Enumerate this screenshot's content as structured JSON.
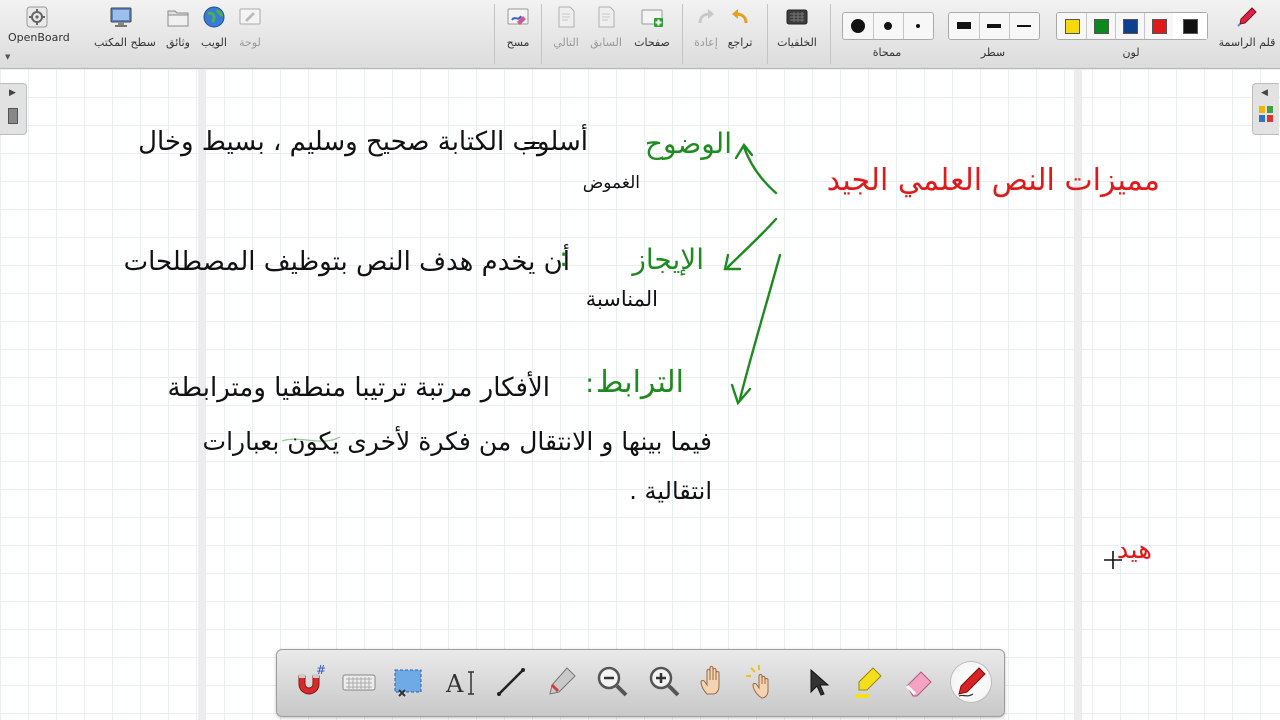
{
  "toolbar": {
    "app_label": "OpenBoard",
    "left_items": [
      {
        "label": "سطح المكتب",
        "icon": "desktop-icon",
        "dim": false
      },
      {
        "label": "وثائق",
        "icon": "folder-icon",
        "dim": false
      },
      {
        "label": "الويب",
        "icon": "globe-icon",
        "dim": false
      },
      {
        "label": "لوحة",
        "icon": "board-icon",
        "dim": true
      }
    ],
    "erase_label": "مسح",
    "pages": [
      {
        "label": "التالي",
        "icon": "next-page-icon",
        "dim": true
      },
      {
        "label": "السابق",
        "icon": "previous-page-icon",
        "dim": true
      },
      {
        "label": "صفحات",
        "icon": "add-page-icon",
        "dim": false
      }
    ],
    "history": [
      {
        "label": "إعادة",
        "icon": "redo-icon",
        "dim": true
      },
      {
        "label": "تراجع",
        "icon": "undo-icon",
        "dim": false
      }
    ],
    "backgrounds_label": "الخلفيات",
    "eraser_label": "ممحاة",
    "line_label": "سطر",
    "color_label": "لون",
    "pen_label": "قلم الراسمة",
    "colors": [
      "#f5d90a",
      "#0a8a1a",
      "#0d3f8e",
      "#e31818",
      "#111111"
    ],
    "selected_color": "#111111"
  },
  "board": {
    "title": "مميزات النص العلمي الجيد",
    "items": [
      {
        "heading": "الوضوح",
        "body": "أسلوب الكتابة صحيح وسليم ، بسيط وخال",
        "cont": "الغموض"
      },
      {
        "heading": "الإيجاز",
        "body": "أن يخدم هدف النص بتوظيف المصطلحات",
        "cont": "المناسبة"
      },
      {
        "heading": "الترابط",
        "body": "الأفكار مرتبة ترتيبا منطقيا ومترابطة",
        "cont": "فيما بينها و الانتقال من فكرة لأخرى يكون بعبارات",
        "cont2": "انتقالية ."
      }
    ],
    "note": "هيد"
  },
  "dock": [
    "magnet-icon",
    "keyboard-icon",
    "capture-icon",
    "text-tool-icon",
    "line-tool-icon",
    "marker-tool-icon",
    "zoom-out-icon",
    "zoom-in-icon",
    "hand-icon",
    "laser-pointer-icon",
    "selector-icon",
    "highlighter-icon",
    "eraser-icon",
    "pen-icon"
  ]
}
